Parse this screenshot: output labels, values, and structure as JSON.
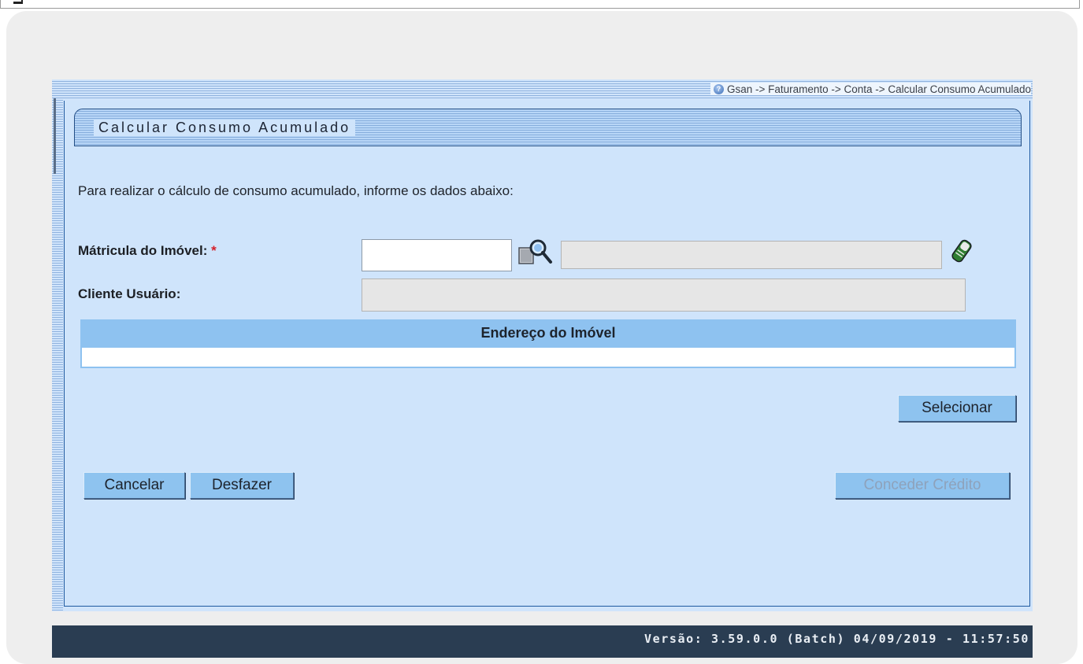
{
  "breadcrumb": "Gsan -> Faturamento -> Conta -> Calcular Consumo Acumulado",
  "page_title": "Calcular Consumo Acumulado",
  "instructions": "Para realizar o cálculo de consumo acumulado, informe os dados abaixo:",
  "form": {
    "matricula_label": "Mátricula do Imóvel:",
    "required_mark": "*",
    "matricula_value": "",
    "matricula_description": "",
    "cliente_label": "Cliente Usuário:",
    "cliente_value": ""
  },
  "address_table": {
    "header": "Endereço do Imóvel",
    "rows": [
      ""
    ]
  },
  "buttons": {
    "selecionar": "Selecionar",
    "cancelar": "Cancelar",
    "desfazer": "Desfazer",
    "conceder_credito": "Conceder Crédito"
  },
  "footer": {
    "version": "Versão: 3.59.0.0 (Batch) 04/09/2019 - 11:57:50"
  },
  "icons": {
    "help": "help-icon",
    "search": "search-icon",
    "clear": "eraser-icon"
  },
  "colors": {
    "panel_bg": "#cfe4fb",
    "header_blue": "#8ec2f0",
    "footer_bg": "#2a3d52",
    "required": "#d4202a"
  }
}
